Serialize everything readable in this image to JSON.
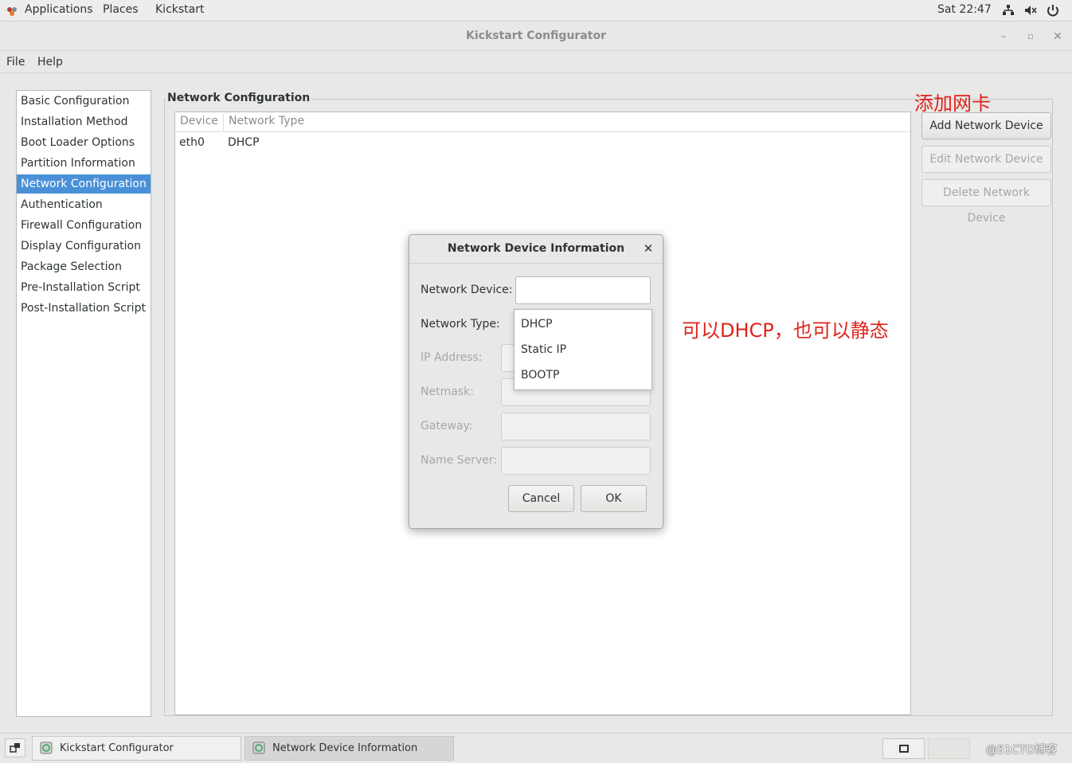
{
  "topbar": {
    "applications": "Applications",
    "places": "Places",
    "kickstart": "Kickstart",
    "clock": "Sat 22:47"
  },
  "window": {
    "title": "Kickstart Configurator"
  },
  "menu": {
    "file": "File",
    "help": "Help"
  },
  "sidebar": {
    "items": [
      {
        "label": "Basic Configuration"
      },
      {
        "label": "Installation Method"
      },
      {
        "label": "Boot Loader Options"
      },
      {
        "label": "Partition Information"
      },
      {
        "label": "Network Configuration",
        "selected": true
      },
      {
        "label": "Authentication"
      },
      {
        "label": "Firewall Configuration"
      },
      {
        "label": "Display Configuration"
      },
      {
        "label": "Package Selection"
      },
      {
        "label": "Pre-Installation Script"
      },
      {
        "label": "Post-Installation Script"
      }
    ]
  },
  "network": {
    "frame_label": "Network Configuration",
    "columns": [
      "Device",
      "Network Type"
    ],
    "rows": [
      {
        "device": "eth0",
        "type": "DHCP"
      }
    ],
    "buttons": {
      "add": "Add Network Device",
      "edit": "Edit Network Device",
      "delete": "Delete Network Device"
    }
  },
  "annotations": {
    "add_nic": "添加网卡",
    "dhcp_or_static": "可以DHCP，也可以静态"
  },
  "dialog": {
    "title": "Network Device Information",
    "fields": {
      "device_label": "Network Device:",
      "device_value": "",
      "type_label": "Network Type:",
      "ip_label": "IP Address:",
      "netmask_label": "Netmask:",
      "gateway_label": "Gateway:",
      "nameserver_label": "Name Server:"
    },
    "type_options": [
      "DHCP",
      "Static IP",
      "BOOTP"
    ],
    "cancel": "Cancel",
    "ok": "OK"
  },
  "taskbar": {
    "tasks": [
      {
        "label": "Kickstart Configurator"
      },
      {
        "label": "Network Device Information",
        "active": true
      }
    ],
    "watermark": "@51CTO博客"
  },
  "colors": {
    "selection": "#4a90d9",
    "annotation": "#e0231b"
  }
}
